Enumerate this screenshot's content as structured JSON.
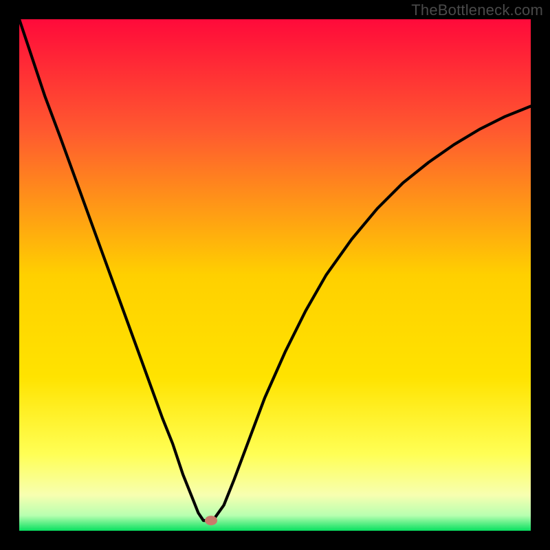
{
  "watermark": "TheBottleneck.com",
  "chart_data": {
    "type": "line",
    "title": "",
    "xlabel": "",
    "ylabel": "",
    "xlim": [
      0,
      100
    ],
    "ylim": [
      0,
      100
    ],
    "x": [
      0,
      2,
      5,
      8,
      12,
      16,
      20,
      24,
      28,
      30,
      32,
      34,
      35,
      36,
      37,
      38,
      40,
      42,
      45,
      48,
      52,
      56,
      60,
      65,
      70,
      75,
      80,
      85,
      90,
      95,
      100
    ],
    "values": [
      100,
      94,
      85,
      77,
      66,
      55,
      44,
      33,
      22,
      17,
      11,
      6,
      3.5,
      2,
      2,
      2.2,
      5,
      10,
      18,
      26,
      35,
      43,
      50,
      57,
      63,
      68,
      72,
      75.5,
      78.5,
      81,
      83
    ],
    "marker": {
      "x": 37.5,
      "y": 2
    }
  },
  "colors": {
    "top": "#ff0a3a",
    "mid1": "#ff6a2a",
    "mid2": "#ffd000",
    "mid3": "#ffff55",
    "mid4": "#f7ffb0",
    "bottom": "#08e060",
    "curve": "#000000",
    "marker": "#c97a6a"
  }
}
